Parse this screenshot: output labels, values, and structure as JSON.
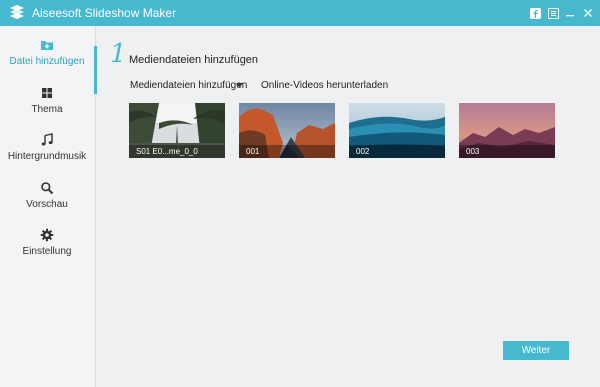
{
  "app": {
    "title": "Aiseesoft Slideshow Maker"
  },
  "titlebar": {
    "icons": [
      "facebook-icon",
      "menu-icon",
      "minimize-icon",
      "close-icon"
    ]
  },
  "sidebar": {
    "items": [
      {
        "label": "Datei hinzufügen",
        "icon": "folder-add-icon",
        "active": true
      },
      {
        "label": "Thema",
        "icon": "grid-icon"
      },
      {
        "label": "Hintergrundmusik",
        "icon": "music-note-icon"
      },
      {
        "label": "Vorschau",
        "icon": "search-icon"
      },
      {
        "label": "Einstellung",
        "icon": "gear-icon"
      }
    ]
  },
  "main": {
    "step_number": "1",
    "step_title": "Mediendateien hinzufügen",
    "add_media_label": "Mediendateien hinzufügen",
    "online_videos_label": "Online-Videos herunterladen",
    "thumbnails": [
      {
        "caption": "S01 E0...me_0_0",
        "selected": true
      },
      {
        "caption": "001"
      },
      {
        "caption": "002"
      },
      {
        "caption": "003"
      }
    ],
    "next_button": "Weiter"
  },
  "colors": {
    "accent": "#46b9cf",
    "background": "#eef0f2",
    "sidebar": "#f3f4f6"
  }
}
